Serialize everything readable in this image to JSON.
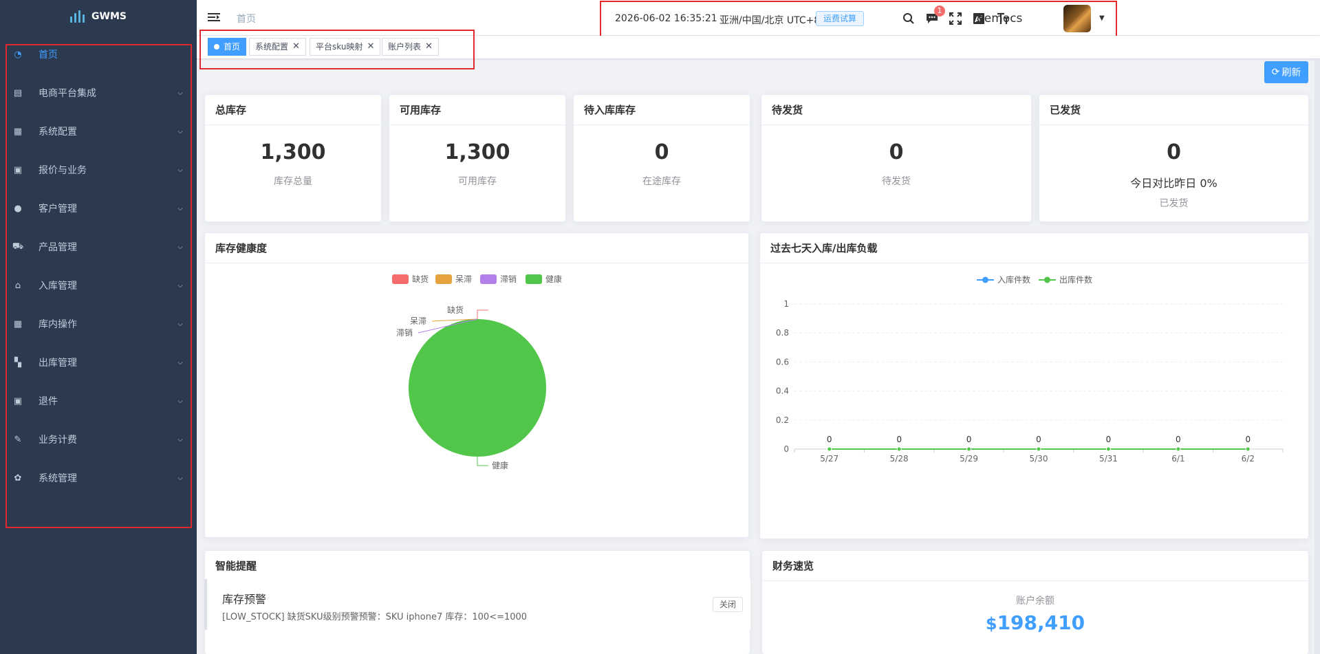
{
  "app": {
    "name": "GWMS"
  },
  "sidebar": {
    "items": [
      {
        "label": "首页",
        "icon": "dashboard-icon",
        "active": true
      },
      {
        "label": "电商平台集成",
        "icon": "store-icon"
      },
      {
        "label": "系统配置",
        "icon": "config-icon"
      },
      {
        "label": "报价与业务",
        "icon": "quote-icon"
      },
      {
        "label": "客户管理",
        "icon": "user-icon"
      },
      {
        "label": "产品管理",
        "icon": "cart-icon"
      },
      {
        "label": "入库管理",
        "icon": "home-icon"
      },
      {
        "label": "库内操作",
        "icon": "grid-icon"
      },
      {
        "label": "出库管理",
        "icon": "apps-icon"
      },
      {
        "label": "退件",
        "icon": "return-icon"
      },
      {
        "label": "业务计费",
        "icon": "billing-icon"
      },
      {
        "label": "系统管理",
        "icon": "gear-icon"
      }
    ]
  },
  "header": {
    "breadcrumb": "首页",
    "datetime": "2026-06-02 16:35:21",
    "timezone": "亚洲/中国/北京 UTC+8",
    "freight_button": "运费试算",
    "message_badge": "1",
    "username": "democs"
  },
  "tabs": [
    {
      "label": "首页",
      "active": true
    },
    {
      "label": "系统配置"
    },
    {
      "label": "平台sku映射"
    },
    {
      "label": "账户列表"
    }
  ],
  "toolbar": {
    "refresh_label": "刷新"
  },
  "stats": [
    {
      "title": "总库存",
      "value": "1,300",
      "sub": "库存总量"
    },
    {
      "title": "可用库存",
      "value": "1,300",
      "sub": "可用库存"
    },
    {
      "title": "待入库库存",
      "value": "0",
      "sub": "在途库存"
    },
    {
      "title": "待发货",
      "value": "0",
      "sub": "待发货"
    },
    {
      "title": "已发货",
      "value": "0",
      "compare": "今日对比昨日 0%",
      "sub": "已发货"
    }
  ],
  "health_card": {
    "title": "库存健康度"
  },
  "load_card": {
    "title": "过去七天入库/出库负载"
  },
  "chart_data": [
    {
      "type": "pie",
      "title": "库存健康度",
      "legend_position": "top",
      "labels": [
        "缺货",
        "呆滞",
        "滞销",
        "健康"
      ],
      "values": [
        0,
        0,
        0,
        1300
      ],
      "colors": [
        "#f56c6c",
        "#e6a23c",
        "#b37feb",
        "#52c54b"
      ]
    },
    {
      "type": "line",
      "title": "过去七天入库/出库负载",
      "legend_position": "top",
      "categories": [
        "5/27",
        "5/28",
        "5/29",
        "5/30",
        "5/31",
        "6/1",
        "6/2"
      ],
      "yticks": [
        "0",
        "0.2",
        "0.4",
        "0.6",
        "0.8",
        "1"
      ],
      "ylim": [
        0,
        1
      ],
      "grid": true,
      "series": [
        {
          "name": "入库件数",
          "values": [
            0,
            0,
            0,
            0,
            0,
            0,
            0
          ],
          "color": "#409eff"
        },
        {
          "name": "出库件数",
          "values": [
            0,
            0,
            0,
            0,
            0,
            0,
            0
          ],
          "color": "#52c54b"
        }
      ]
    }
  ],
  "alerts": {
    "title": "智能提醒",
    "items": [
      {
        "title": "库存预警",
        "message": "[LOW_STOCK] 缺货SKU级别预警预警：SKU iphone7 库存：100<=1000",
        "close_label": "关闭"
      }
    ]
  },
  "finance": {
    "title": "财务速览",
    "balance_label": "账户余额",
    "currency": "$",
    "balance": "198,410"
  }
}
